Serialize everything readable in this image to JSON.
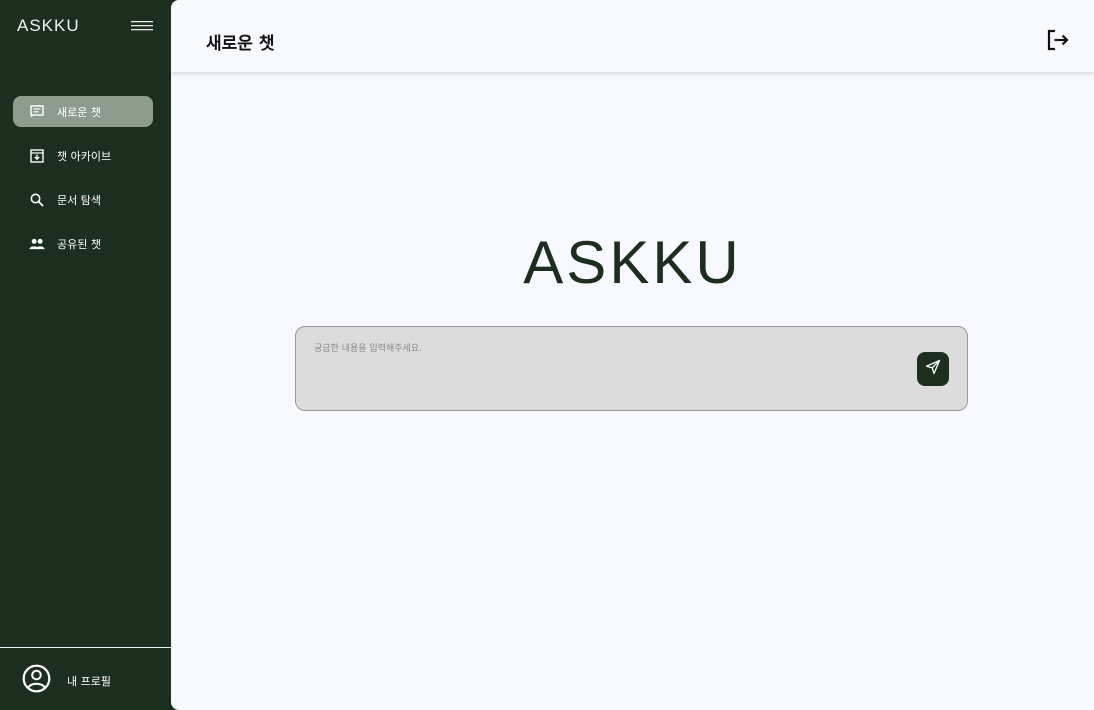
{
  "app": {
    "brand": "ASKKU",
    "accent_color": "#1c2f1e",
    "active_highlight": "#8e9c8e"
  },
  "sidebar": {
    "menu_icon": "hamburger-icon",
    "items": [
      {
        "label": "새로운 챗",
        "icon": "chat-icon",
        "active": true
      },
      {
        "label": "챗 아카이브",
        "icon": "archive-icon",
        "active": false
      },
      {
        "label": "문서 탐색",
        "icon": "search-icon",
        "active": false
      },
      {
        "label": "공유된 챗",
        "icon": "people-icon",
        "active": false
      }
    ],
    "profile": {
      "label": "내 프로필",
      "icon": "user-circle-icon"
    }
  },
  "header": {
    "title": "새로운 챗",
    "logout_icon": "logout-icon"
  },
  "main": {
    "logo": "ASKKU",
    "chat_input": {
      "placeholder": "궁금한 내용을 입력해주세요.",
      "value": ""
    },
    "send_icon": "send-icon"
  }
}
